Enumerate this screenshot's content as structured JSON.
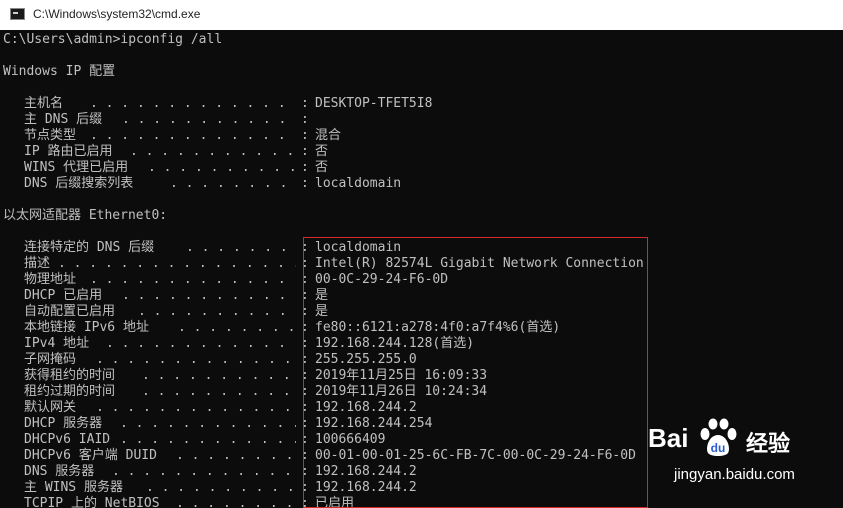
{
  "window": {
    "title": "C:\\Windows\\system32\\cmd.exe"
  },
  "console": {
    "prompt_line": "C:\\Users\\admin>ipconfig /all",
    "section_windows": "Windows IP 配置",
    "global": [
      {
        "label": "主机名",
        "value": "DESKTOP-TFET5I8"
      },
      {
        "label": "主 DNS 后缀",
        "value": ""
      },
      {
        "label": "节点类型",
        "value": "混合"
      },
      {
        "label": "IP 路由已启用",
        "value": "否"
      },
      {
        "label": "WINS 代理已启用",
        "value": "否"
      },
      {
        "label": "DNS 后缀搜索列表",
        "value": "localdomain"
      }
    ],
    "section_adapter": "以太网适配器 Ethernet0:",
    "adapter": [
      {
        "label": "连接特定的 DNS 后缀",
        "value": "localdomain"
      },
      {
        "label": "描述",
        "value": "Intel(R) 82574L Gigabit Network Connection"
      },
      {
        "label": "物理地址",
        "value": "00-0C-29-24-F6-0D"
      },
      {
        "label": "DHCP 已启用",
        "value": "是"
      },
      {
        "label": "自动配置已启用",
        "value": "是"
      },
      {
        "label": "本地链接 IPv6 地址",
        "value": "fe80::6121:a278:4f0:a7f4%6(首选)"
      },
      {
        "label": "IPv4 地址",
        "value": "192.168.244.128(首选)"
      },
      {
        "label": "子网掩码",
        "value": "255.255.255.0"
      },
      {
        "label": "获得租约的时间",
        "value": "2019年11月25日 16:09:33"
      },
      {
        "label": "租约过期的时间",
        "value": "2019年11月26日 10:24:34"
      },
      {
        "label": "默认网关",
        "value": "192.168.244.2"
      },
      {
        "label": "DHCP 服务器",
        "value": "192.168.244.254"
      },
      {
        "label": "DHCPv6 IAID",
        "value": "100666409"
      },
      {
        "label": "DHCPv6 客户端 DUID",
        "value": "00-01-00-01-25-6C-FB-7C-00-0C-29-24-F6-0D"
      },
      {
        "label": "DNS 服务器",
        "value": "192.168.244.2"
      },
      {
        "label": "主 WINS 服务器",
        "value": "192.168.244.2"
      },
      {
        "label": "TCPIP 上的 NetBIOS",
        "value": "已启用"
      }
    ]
  },
  "watermark": {
    "brand": "Bai",
    "brand_cn": "经验",
    "url": "jingyan.baidu.com"
  },
  "colors": {
    "console_bg": "#0c0c0c",
    "console_text": "#c0c0c0",
    "highlight_border": "#d42a2a"
  }
}
